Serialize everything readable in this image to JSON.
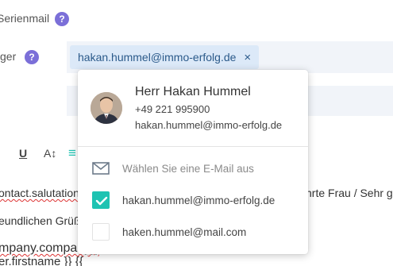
{
  "form": {
    "serienmail_label": "Serienmail",
    "empfaenger_label": "ger",
    "help_glyph": "?",
    "recipient_chip": "hakan.hummel@immo-erfolg.de",
    "chip_remove": "×"
  },
  "toolbar": {
    "underline": "U",
    "font_size": "A↕",
    "align": "≡"
  },
  "editor": {
    "line1_left": "ontact.salutationl",
    "line1_right": "hrte Frau / Sehr ge",
    "line2": "eundlichen Grüße",
    "line3": "mpany.company",
    "line3_suffix": "}}",
    "line4": "er.firstname }} {{"
  },
  "popup": {
    "name": "Herr Hakan Hummel",
    "phone": "+49 221 995900",
    "email": "hakan.hummel@immo-erfolg.de",
    "options": [
      {
        "label": "Wählen Sie eine E-Mail aus",
        "kind": "hint",
        "icon": "envelope-icon"
      },
      {
        "label": "hakan.hummel@immo-erfolg.de",
        "kind": "checkbox",
        "checked": true
      },
      {
        "label": "haken.hummel@mail.com",
        "kind": "checkbox",
        "checked": false
      }
    ]
  },
  "colors": {
    "accent_help": "#7b6fd8",
    "chip_bg": "#dce9f8",
    "check_teal": "#1ec3b2"
  }
}
